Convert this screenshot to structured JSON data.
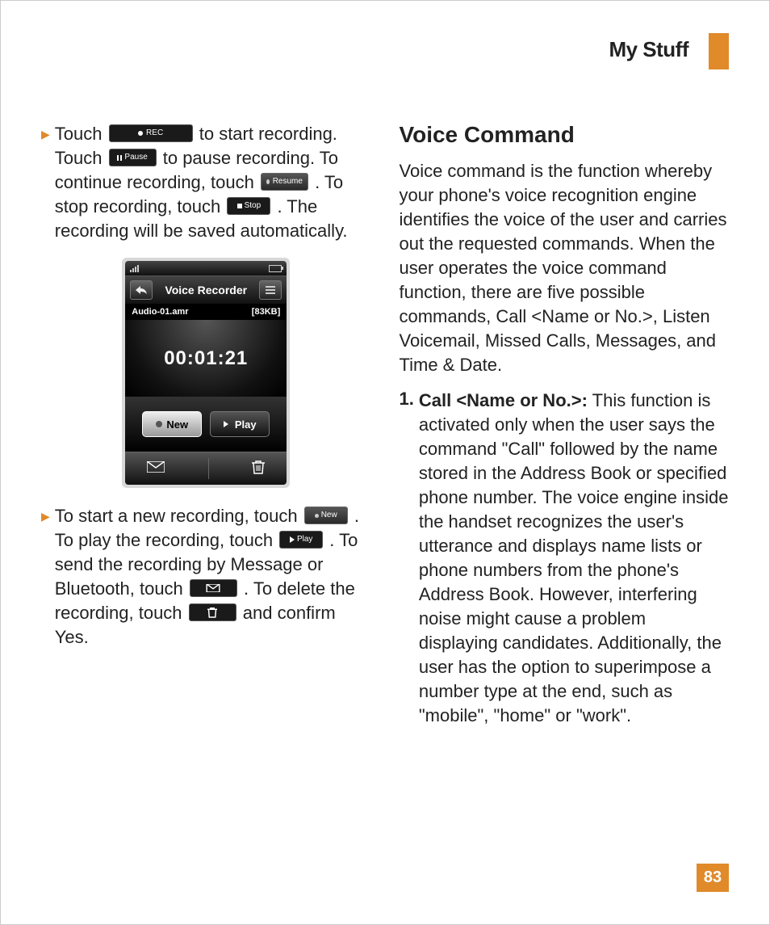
{
  "header": {
    "title": "My Stuff"
  },
  "left": {
    "para1": {
      "t1": "Touch ",
      "rec_label": "REC",
      "t2": " to start recording. Touch ",
      "pause_label": "Pause",
      "t3": " to pause recording. To continue recording, touch ",
      "resume_label": "Resume",
      "t4": ". To stop recording, touch ",
      "stop_label": "Stop",
      "t5": ". The recording will be saved automatically."
    },
    "phone": {
      "title": "Voice Recorder",
      "filename": "Audio-01.amr",
      "filesize": "[83KB]",
      "timer": "00:01:21",
      "new_label": "New",
      "play_label": "Play"
    },
    "para2": {
      "t1": "To start a new recording, touch ",
      "new_label": "New",
      "t2": ". To play the recording, touch ",
      "play_label": "Play",
      "t3": " . To send the recording by Message or Bluetooth, touch ",
      "t4": ". To delete the recording, touch ",
      "t5": " and confirm Yes."
    }
  },
  "right": {
    "heading": "Voice Command",
    "intro": "Voice command is the function whereby your phone's voice recognition engine identifies the voice of the user and carries out the requested commands. When the user operates the voice command function, there are five possible commands, Call <Name or No.>, Listen Voicemail, Missed Calls, Messages, and Time & Date.",
    "item1": {
      "num": "1.",
      "title": "Call <Name or No.>:",
      "body": " This function is activated only when the user says the command \"Call\" followed by the name stored in the Address Book or specified phone number. The voice engine inside the handset recognizes the user's utterance and displays name lists or phone numbers from the phone's Address Book. However, interfering noise might cause a problem displaying candidates. Additionally, the user has the option to superimpose a number type at the end, such as \"mobile\", \"home\" or \"work\"."
    }
  },
  "page_number": "83"
}
